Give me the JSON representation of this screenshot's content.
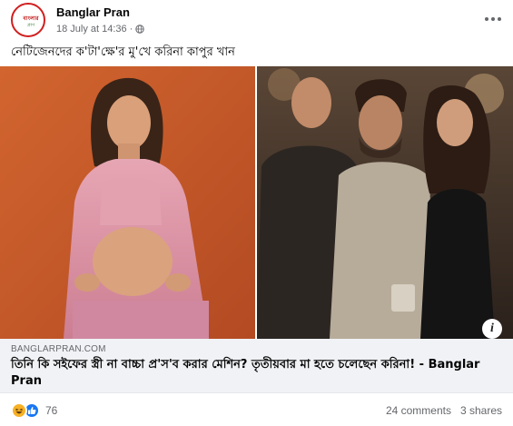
{
  "post": {
    "avatar": {
      "line1": "বাংলার",
      "line2": "প্রাণ"
    },
    "page_name": "Banglar Pran",
    "timestamp": "18 July at 14:36",
    "separator": "·",
    "caption": "নেটিজেনদের ক'টা'ক্ষে'র মু'খে করিনা কাপুর খান",
    "link": {
      "domain": "BANGLARPRAN.COM",
      "title": "তিনি কি সইফের স্ত্রী না বাচ্চা প্র'স'ব করার মেশিন? তৃতীয়বার মা হতে চলেছেন করিনা! - Banglar Pran"
    },
    "info_symbol": "i",
    "reactions": {
      "count": "76",
      "types": [
        "haha-icon",
        "like-icon"
      ]
    },
    "comments": "24 comments",
    "shares": "3 shares"
  },
  "colors": {
    "brand_red": "#d11f1f",
    "like_blue": "#1877f2",
    "haha_yellow": "#f7b125",
    "meta_gray": "#65676b",
    "preview_bg": "#f0f2f5"
  }
}
